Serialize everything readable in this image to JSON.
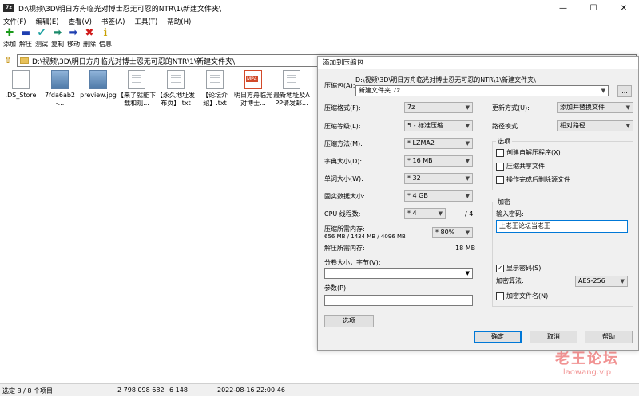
{
  "window": {
    "title": "D:\\视频\\3D\\明日方舟临光对博士忍无可忍的NTR\\1\\新建文件夹\\",
    "app_icon": "7z",
    "minimize": "—",
    "maximize": "☐",
    "close": "✕"
  },
  "menu": [
    "文件(F)",
    "编辑(E)",
    "查看(V)",
    "书签(A)",
    "工具(T)",
    "帮助(H)"
  ],
  "toolbar": [
    {
      "label": "添加",
      "icon": "plus-icon",
      "glyph": "✚",
      "color": "#1a9a1a"
    },
    {
      "label": "解压",
      "icon": "minus-icon",
      "glyph": "▬",
      "color": "#1f3fb0"
    },
    {
      "label": "测试",
      "icon": "check-icon",
      "glyph": "✔",
      "color": "#1aa0a0"
    },
    {
      "label": "复制",
      "icon": "copy-arrow-icon",
      "glyph": "➡",
      "color": "#1a8a6a"
    },
    {
      "label": "移动",
      "icon": "move-arrow-icon",
      "glyph": "➡",
      "color": "#1f3fb0"
    },
    {
      "label": "删除",
      "icon": "delete-icon",
      "glyph": "✖",
      "color": "#d01a1a"
    },
    {
      "label": "信息",
      "icon": "info-icon",
      "glyph": "ℹ",
      "color": "#c8a000"
    }
  ],
  "address": {
    "path": "D:\\视频\\3D\\明日方舟临光对博士忍无可忍的NTR\\1\\新建文件夹\\"
  },
  "files": [
    {
      "name": ".DS_Store",
      "kind": "blank"
    },
    {
      "name": "7fda6ab2-...",
      "kind": "img"
    },
    {
      "name": "preview.jpg",
      "kind": "img"
    },
    {
      "name": "【来了就能下载和观...",
      "kind": "txt"
    },
    {
      "name": "【永久地址发布页】.txt",
      "kind": "txt"
    },
    {
      "name": "【论坛介绍】.txt",
      "kind": "txt"
    },
    {
      "name": "明日方舟临光对博士...",
      "kind": "mp4"
    },
    {
      "name": "最新地址及APP请发邮...",
      "kind": "txt"
    }
  ],
  "status": {
    "selection": "选定 8 / 8 个项目",
    "size": "2 798 098 682",
    "packed": "6 148",
    "date": "2022-08-16 22:00:46"
  },
  "dialog": {
    "title": "添加到压缩包",
    "archive_label": "压缩包(A):",
    "archive_dir": "D:\\视频\\3D\\明日方舟临光对博士忍无可忍的NTR\\1\\新建文件夹\\",
    "archive_name": "新建文件夹 7z",
    "browse": "...",
    "format_label": "压缩格式(F):",
    "format_value": "7z",
    "level_label": "压缩等级(L):",
    "level_value": "5 - 标准压缩",
    "method_label": "压缩方法(M):",
    "method_value": "* LZMA2",
    "dict_label": "字典大小(D):",
    "dict_value": "* 16 MB",
    "word_label": "单词大小(W):",
    "word_value": "* 32",
    "solid_label": "固实数据大小:",
    "solid_value": "* 4 GB",
    "threads_label": "CPU 线程数:",
    "threads_value": "* 4",
    "threads_total": "/ 4",
    "mem_comp_label": "压缩所需内存:",
    "mem_comp_detail": "656 MB / 1434 MB / 4096 MB",
    "mem_comp_pct": "* 80%",
    "mem_decomp_label": "解压所需内存:",
    "mem_decomp_value": "18 MB",
    "volume_label": "分卷大小，字节(V):",
    "volume_value": "",
    "params_label": "参数(P):",
    "params_value": "",
    "options_btn": "选项",
    "update_label": "更新方式(U):",
    "update_value": "添加并替换文件",
    "path_label": "路径模式",
    "path_value": "相对路径",
    "options_group": "选项",
    "opt_sfx": "创建自解压程序(X)",
    "opt_shared": "压缩共享文件",
    "opt_delete": "操作完成后删除源文件",
    "encryption_group": "加密",
    "password_label": "输入密码:",
    "password_value": "上老王论坛当老王",
    "show_password": "显示密码(S)",
    "enc_method_label": "加密算法:",
    "enc_method_value": "AES-256",
    "encrypt_names": "加密文件名(N)",
    "ok": "确定",
    "cancel": "取消",
    "help": "帮助"
  },
  "watermark": {
    "main": "老王论坛",
    "sub": "laowang.vip"
  }
}
